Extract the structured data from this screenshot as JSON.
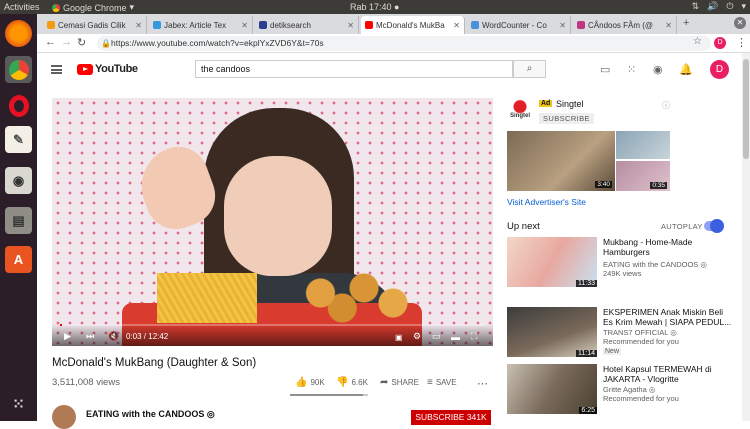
{
  "system": {
    "activities": "Activities",
    "app_name": "Google Chrome",
    "clock": "Rab 17:40 ●"
  },
  "tabs": [
    {
      "label": "Cemasi Gadis Cilik",
      "color": "#f39c12"
    },
    {
      "label": "Jabex: Article Tex",
      "color": "#3498db"
    },
    {
      "label": "detiksearch",
      "color": "#2c3e8f"
    },
    {
      "label": "McDonald's MukBa",
      "color": "#ff0000"
    },
    {
      "label": "WordCounter - Co",
      "color": "#4a90d9"
    },
    {
      "label": "CÅndoos FÅm (@",
      "color": "#c13584"
    }
  ],
  "address_bar": {
    "url": "https://www.youtube.com/watch?v=ekplYxZVD6Y&t=70s"
  },
  "youtube": {
    "logo_text": "YouTube",
    "search_value": "the candoos",
    "avatar_letter": "D"
  },
  "player": {
    "time": "0:03 / 12:42",
    "progress": 0.004
  },
  "video": {
    "title": "McDonald's MukBang (Daughter & Son)",
    "views": "3,511,008 views",
    "likes": "90K",
    "dislikes": "6.6K",
    "share": "SHARE",
    "save": "SAVE",
    "like_ratio": 0.93,
    "channel": "EATING with the CANDOOS ◎",
    "subscribe": "SUBSCRIBE 341K"
  },
  "ad": {
    "badge": "Ad",
    "advertiser": "Singtel",
    "logo_text": "Singtel",
    "subscribe": "SUBSCRIBE",
    "dur1": "3:40",
    "dur2": "0:35",
    "visit": "Visit Advertiser's Site"
  },
  "sidebar": {
    "up_next": "Up next",
    "autoplay": "AUTOPLAY",
    "recommendations": [
      {
        "title": "Mukbang - Home-Made Hamburgers",
        "channel": "EATING with the CANDOOS ◎",
        "meta": "249K views",
        "duration": "11:33",
        "badge": ""
      },
      {
        "title": "EKSPERIMEN Anak Miskin Beli Es Krim Mewah | SIAPA PEDUL...",
        "channel": "TRANS7 OFFICIAL ◎",
        "meta": "Recommended for you",
        "duration": "11:14",
        "badge": "New"
      },
      {
        "title": "Hotel Kapsul TERMEWAH di JAKARTA - Vlogritte",
        "channel": "Gritte Agatha ◎",
        "meta": "Recommended for you",
        "duration": "6:25",
        "badge": ""
      }
    ]
  }
}
